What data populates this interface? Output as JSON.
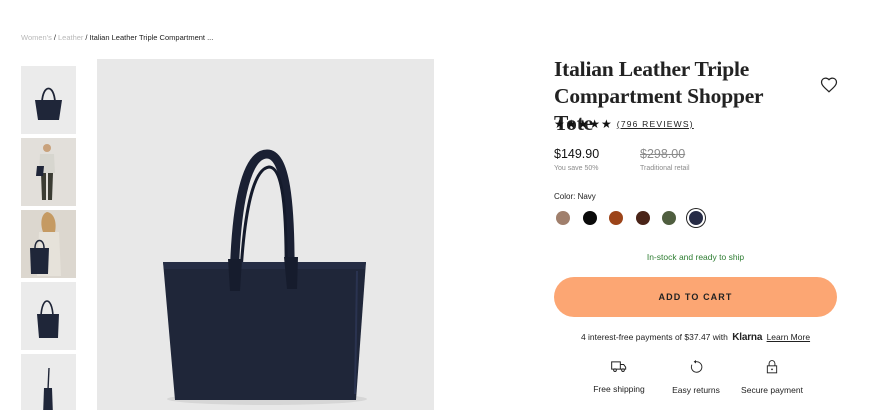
{
  "breadcrumb": {
    "items": [
      "Women's",
      "Leather",
      "Italian Leather Triple Compartment ..."
    ],
    "separator": "/"
  },
  "gallery": {
    "thumbnail_icons": [
      "tote-bag-thumbnail",
      "model-standing-thumbnail",
      "model-carrying-bag-thumbnail",
      "tote-bag-angle-thumbnail",
      "tote-bag-side-thumbnail"
    ],
    "main_image_icon": "navy-tote-bag-image"
  },
  "product": {
    "title": "Italian Leather Triple Compartment Shopper Tote",
    "stars": "★★★★★",
    "reviews": "(796 REVIEWS)",
    "price": "$149.90",
    "savings": "You save 50%",
    "retail_price": "$298.00",
    "retail_label": "Traditional retail"
  },
  "color": {
    "label": "Color: Navy",
    "swatches": [
      {
        "name": "taupe",
        "hex": "#a07f6c"
      },
      {
        "name": "black",
        "hex": "#0a0a0a"
      },
      {
        "name": "cognac",
        "hex": "#9c4419"
      },
      {
        "name": "brown",
        "hex": "#4a2418"
      },
      {
        "name": "green",
        "hex": "#4f5e3f"
      },
      {
        "name": "navy",
        "hex": "#262b45",
        "selected": true
      }
    ]
  },
  "stock_status": "In-stock and ready to ship",
  "cart_button": "ADD TO CART",
  "klarna": {
    "before": "4 interest-free payments of $37.47 with",
    "logo": "Klarna",
    "link": "Learn More"
  },
  "perks": [
    {
      "label": "Free shipping",
      "icon": "truck-icon"
    },
    {
      "label": "Easy returns",
      "icon": "returns-icon"
    },
    {
      "label": "Secure payment",
      "icon": "lock-icon"
    }
  ],
  "colors": {
    "accent": "#fca673",
    "stock_green": "#2e7d32",
    "bag_navy": "#1f2639",
    "background_gray": "#e8e8e8"
  }
}
